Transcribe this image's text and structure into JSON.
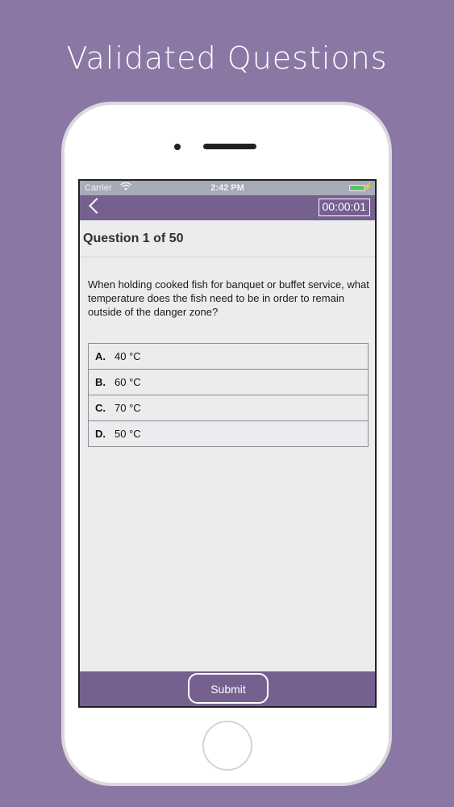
{
  "headline": "Validated Questions",
  "status_bar": {
    "carrier": "Carrier",
    "time": "2:42 PM",
    "wifi_icon": "wifi-icon",
    "battery_level": 1.0,
    "battery_color": "#3ed34a"
  },
  "nav": {
    "back_icon": "chevron-left-icon",
    "timer": "00:00:01",
    "accent_color": "#76608f"
  },
  "question": {
    "title": "Question 1 of 50",
    "text": "When holding cooked fish for banquet or buffet service, what temperature does the fish need to be in order to remain outside of the danger zone?",
    "options": [
      {
        "letter": "A.",
        "text": "40 °C"
      },
      {
        "letter": "B.",
        "text": "60 °C"
      },
      {
        "letter": "C.",
        "text": "70 °C"
      },
      {
        "letter": "D.",
        "text": "50 °C"
      }
    ]
  },
  "footer": {
    "submit_label": "Submit"
  }
}
